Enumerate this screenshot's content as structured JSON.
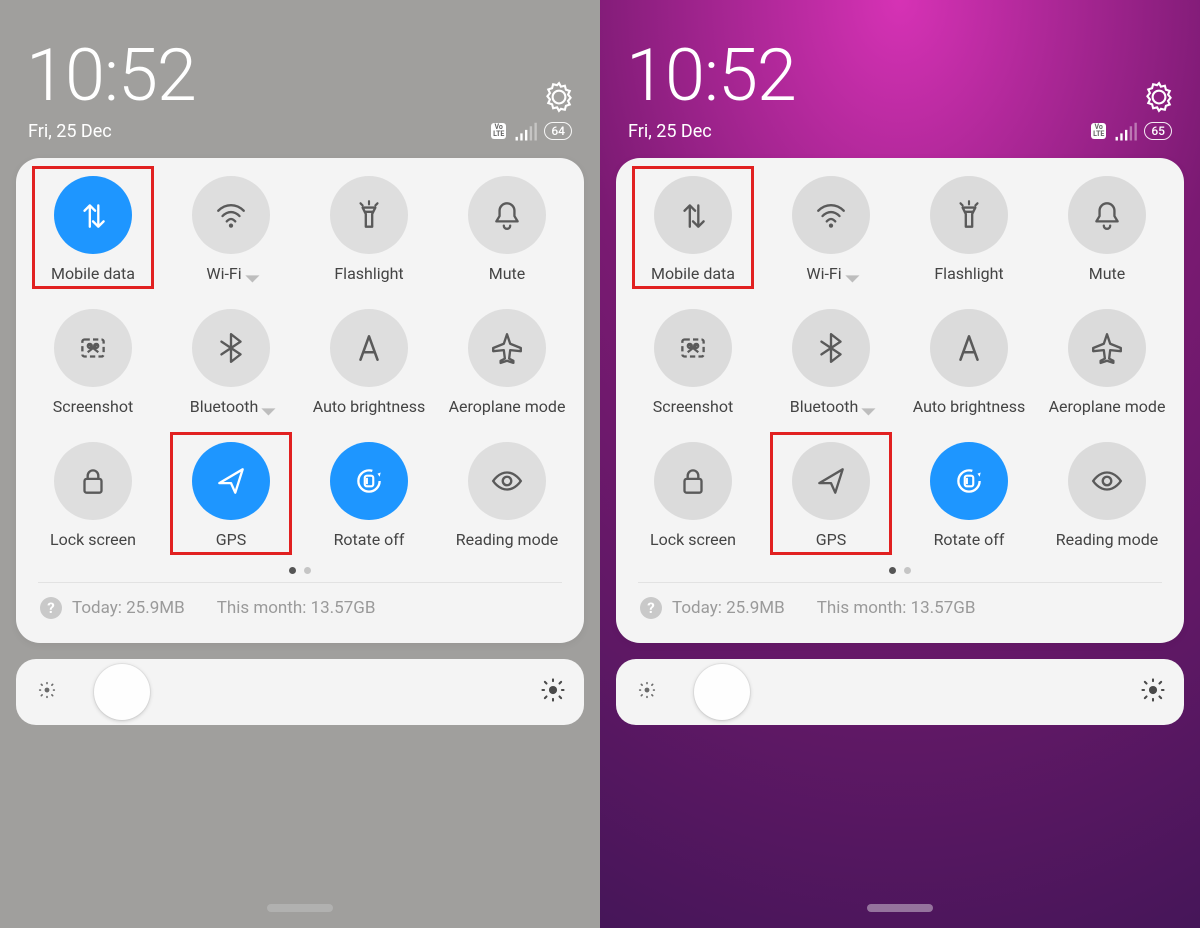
{
  "panels": [
    {
      "time": "10:52",
      "date": "Fri, 25 Dec",
      "battery": "64",
      "tiles": [
        {
          "id": "mobile-data",
          "label": "Mobile data",
          "icon": "data",
          "active": true,
          "highlighted": true,
          "triangle": false
        },
        {
          "id": "wifi",
          "label": "Wi-Fi",
          "icon": "wifi",
          "active": false,
          "highlighted": false,
          "triangle": true
        },
        {
          "id": "flashlight",
          "label": "Flashlight",
          "icon": "flashlight",
          "active": false,
          "highlighted": false,
          "triangle": false
        },
        {
          "id": "mute",
          "label": "Mute",
          "icon": "bell",
          "active": false,
          "highlighted": false,
          "triangle": false
        },
        {
          "id": "screenshot",
          "label": "Screenshot",
          "icon": "screenshot",
          "active": false,
          "highlighted": false,
          "triangle": false
        },
        {
          "id": "bluetooth",
          "label": "Bluetooth",
          "icon": "bluetooth",
          "active": false,
          "highlighted": false,
          "triangle": true
        },
        {
          "id": "auto-brightness",
          "label": "Auto brightness",
          "icon": "letter-a",
          "active": false,
          "highlighted": false,
          "triangle": false
        },
        {
          "id": "aeroplane",
          "label": "Aeroplane mode",
          "icon": "plane",
          "active": false,
          "highlighted": false,
          "triangle": false
        },
        {
          "id": "lock-screen",
          "label": "Lock screen",
          "icon": "lock",
          "active": false,
          "highlighted": false,
          "triangle": false
        },
        {
          "id": "gps",
          "label": "GPS",
          "icon": "navigate",
          "active": true,
          "highlighted": true,
          "triangle": false
        },
        {
          "id": "rotate",
          "label": "Rotate off",
          "icon": "rotate",
          "active": true,
          "highlighted": false,
          "triangle": false
        },
        {
          "id": "reading",
          "label": "Reading mode",
          "icon": "eye",
          "active": false,
          "highlighted": false,
          "triangle": false
        }
      ],
      "usage_today": "Today: 25.9MB",
      "usage_month": "This month: 13.57GB"
    },
    {
      "time": "10:52",
      "date": "Fri, 25 Dec",
      "battery": "65",
      "tiles": [
        {
          "id": "mobile-data",
          "label": "Mobile data",
          "icon": "data",
          "active": false,
          "highlighted": true,
          "triangle": false
        },
        {
          "id": "wifi",
          "label": "Wi-Fi",
          "icon": "wifi",
          "active": false,
          "highlighted": false,
          "triangle": true
        },
        {
          "id": "flashlight",
          "label": "Flashlight",
          "icon": "flashlight",
          "active": false,
          "highlighted": false,
          "triangle": false
        },
        {
          "id": "mute",
          "label": "Mute",
          "icon": "bell",
          "active": false,
          "highlighted": false,
          "triangle": false
        },
        {
          "id": "screenshot",
          "label": "Screenshot",
          "icon": "screenshot",
          "active": false,
          "highlighted": false,
          "triangle": false
        },
        {
          "id": "bluetooth",
          "label": "Bluetooth",
          "icon": "bluetooth",
          "active": false,
          "highlighted": false,
          "triangle": true
        },
        {
          "id": "auto-brightness",
          "label": "Auto brightness",
          "icon": "letter-a",
          "active": false,
          "highlighted": false,
          "triangle": false
        },
        {
          "id": "aeroplane",
          "label": "Aeroplane mode",
          "icon": "plane",
          "active": false,
          "highlighted": false,
          "triangle": false
        },
        {
          "id": "lock-screen",
          "label": "Lock screen",
          "icon": "lock",
          "active": false,
          "highlighted": false,
          "triangle": false
        },
        {
          "id": "gps",
          "label": "GPS",
          "icon": "navigate",
          "active": false,
          "highlighted": true,
          "triangle": false
        },
        {
          "id": "rotate",
          "label": "Rotate off",
          "icon": "rotate",
          "active": true,
          "highlighted": false,
          "triangle": false
        },
        {
          "id": "reading",
          "label": "Reading mode",
          "icon": "eye",
          "active": false,
          "highlighted": false,
          "triangle": false
        }
      ],
      "usage_today": "Today: 25.9MB",
      "usage_month": "This month: 13.57GB"
    }
  ],
  "volte": "Vo\nLTE"
}
